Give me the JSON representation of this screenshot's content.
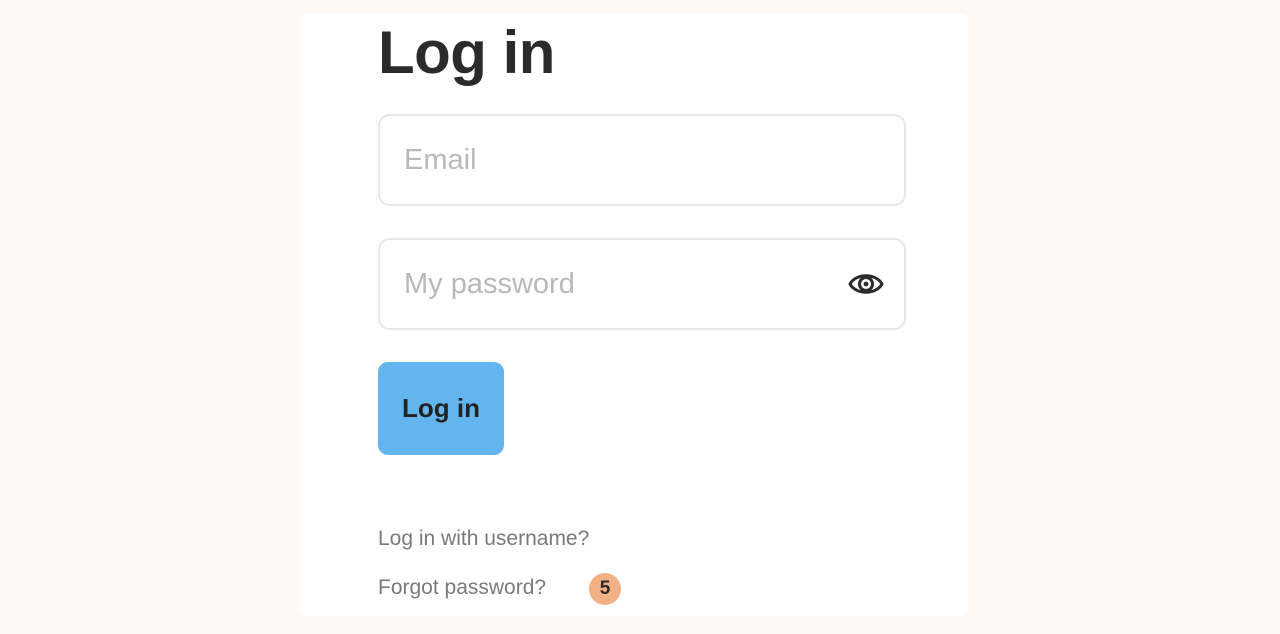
{
  "page": {
    "title": "Log in"
  },
  "form": {
    "email_placeholder": "Email",
    "email_value": "",
    "password_placeholder": "My password",
    "password_value": "",
    "show_password_icon": "eye-icon",
    "submit_label": "Log in"
  },
  "links": {
    "username_login": "Log in with username?",
    "forgot_password": "Forgot password?"
  },
  "badge": {
    "count": "5"
  },
  "colors": {
    "background": "#fff9f5",
    "card": "#ffffff",
    "button": "#63b5f0",
    "badge": "#f2b085",
    "link_text": "#7a7a7a",
    "placeholder": "#b9b9b9"
  }
}
